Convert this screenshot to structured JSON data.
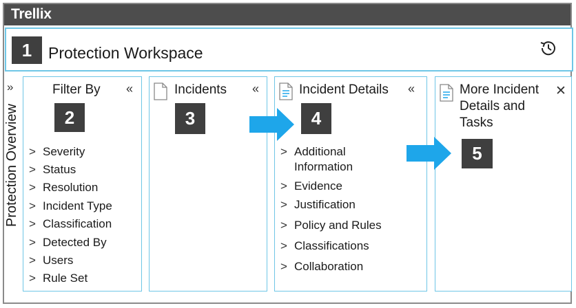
{
  "app": {
    "logo": "Trellix"
  },
  "workspace": {
    "badge": "1",
    "title": "Protection Workspace",
    "refresh_icon": "history-refresh-icon"
  },
  "sidebar": {
    "expand_glyph": "»",
    "label": "Protection Overview"
  },
  "panels": {
    "filter": {
      "title": "Filter By",
      "badge": "2",
      "collapse": "«",
      "items": [
        "Severity",
        "Status",
        "Resolution",
        "Incident Type",
        "Classification",
        "Detected By",
        "Users",
        "Rule Set"
      ]
    },
    "incidents": {
      "title": "Incidents",
      "badge": "3",
      "collapse": "«"
    },
    "details": {
      "title": "Incident Details",
      "badge": "4",
      "collapse": "«",
      "items": [
        "Additional Information",
        "Evidence",
        "Justification",
        "Policy and Rules",
        "Classifications",
        "Collaboration"
      ]
    },
    "more": {
      "title_lines": [
        "More Incident",
        "Details and",
        "Tasks"
      ],
      "badge": "5",
      "close": "✕"
    }
  },
  "chevron_glyph": ">",
  "colors": {
    "accent_border": "#6ec6e6",
    "arrow": "#1ea6ea",
    "badge": "#3f3f3f",
    "topbar": "#4d4d4d"
  }
}
